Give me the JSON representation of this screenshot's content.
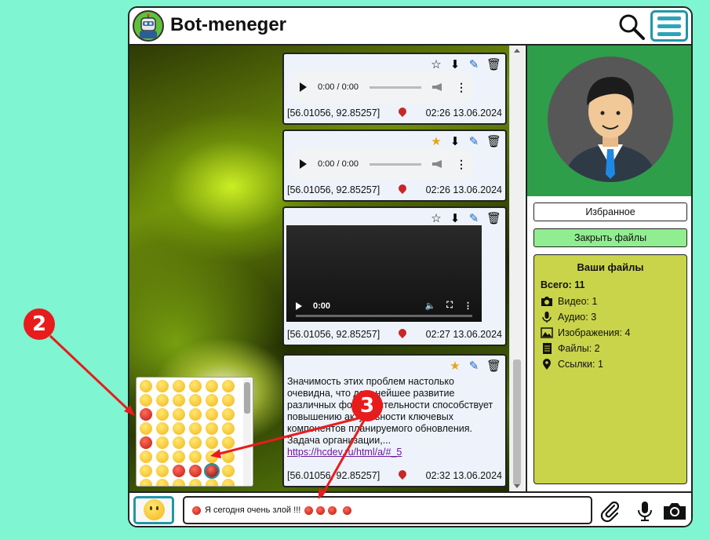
{
  "app": {
    "title": "Bot-meneger"
  },
  "messages": [
    {
      "type": "audio",
      "time_display": "0:00 / 0:00",
      "coords": "[56.01056, 92.85257]",
      "timestamp": "02:26 13.06.2024",
      "starred": false
    },
    {
      "type": "audio",
      "time_display": "0:00 / 0:00",
      "coords": "[56.01056, 92.85257]",
      "timestamp": "02:26 13.06.2024",
      "starred": true
    },
    {
      "type": "video",
      "time_display": "0:00",
      "coords": "[56.01056, 92.85257]",
      "timestamp": "02:27 13.06.2024",
      "starred": false
    },
    {
      "type": "text",
      "text": "Значимость этих проблем настолько очевидна, что дальнейшее развитие различных форм деятельности способствует повышению актуальности ключевых компонентов планируемого обновления. Задача организации,...",
      "link": "https://hcdev.ru/html/a/#_5",
      "coords": "[56.01056, 92.85257]",
      "timestamp": "02:32 13.06.2024",
      "starred": true
    }
  ],
  "input": {
    "value_prefix": "Я сегодня очень злой !!!"
  },
  "sidebar": {
    "favorites_label": "Избранное",
    "close_files_label": "Закрыть файлы",
    "files_title": "Ваши файлы",
    "total_label": "Всего: 11",
    "rows": [
      {
        "label": "Видео: 1",
        "icon": "camera-icon"
      },
      {
        "label": "Аудио: 3",
        "icon": "microphone-icon"
      },
      {
        "label": "Изображения: 4",
        "icon": "image-icon"
      },
      {
        "label": "Файлы: 2",
        "icon": "document-icon"
      },
      {
        "label": "Ссылки: 1",
        "icon": "location-pin-icon"
      }
    ]
  },
  "annotations": {
    "marker_2": "2",
    "marker_3": "3"
  },
  "colors": {
    "background": "#7ff5d1",
    "accent": "#2196a8",
    "files_panel": "#c9d44a",
    "close_button": "#90ee90",
    "avatar_bg": "#2e9e4a",
    "annotation": "#e81c1c"
  }
}
